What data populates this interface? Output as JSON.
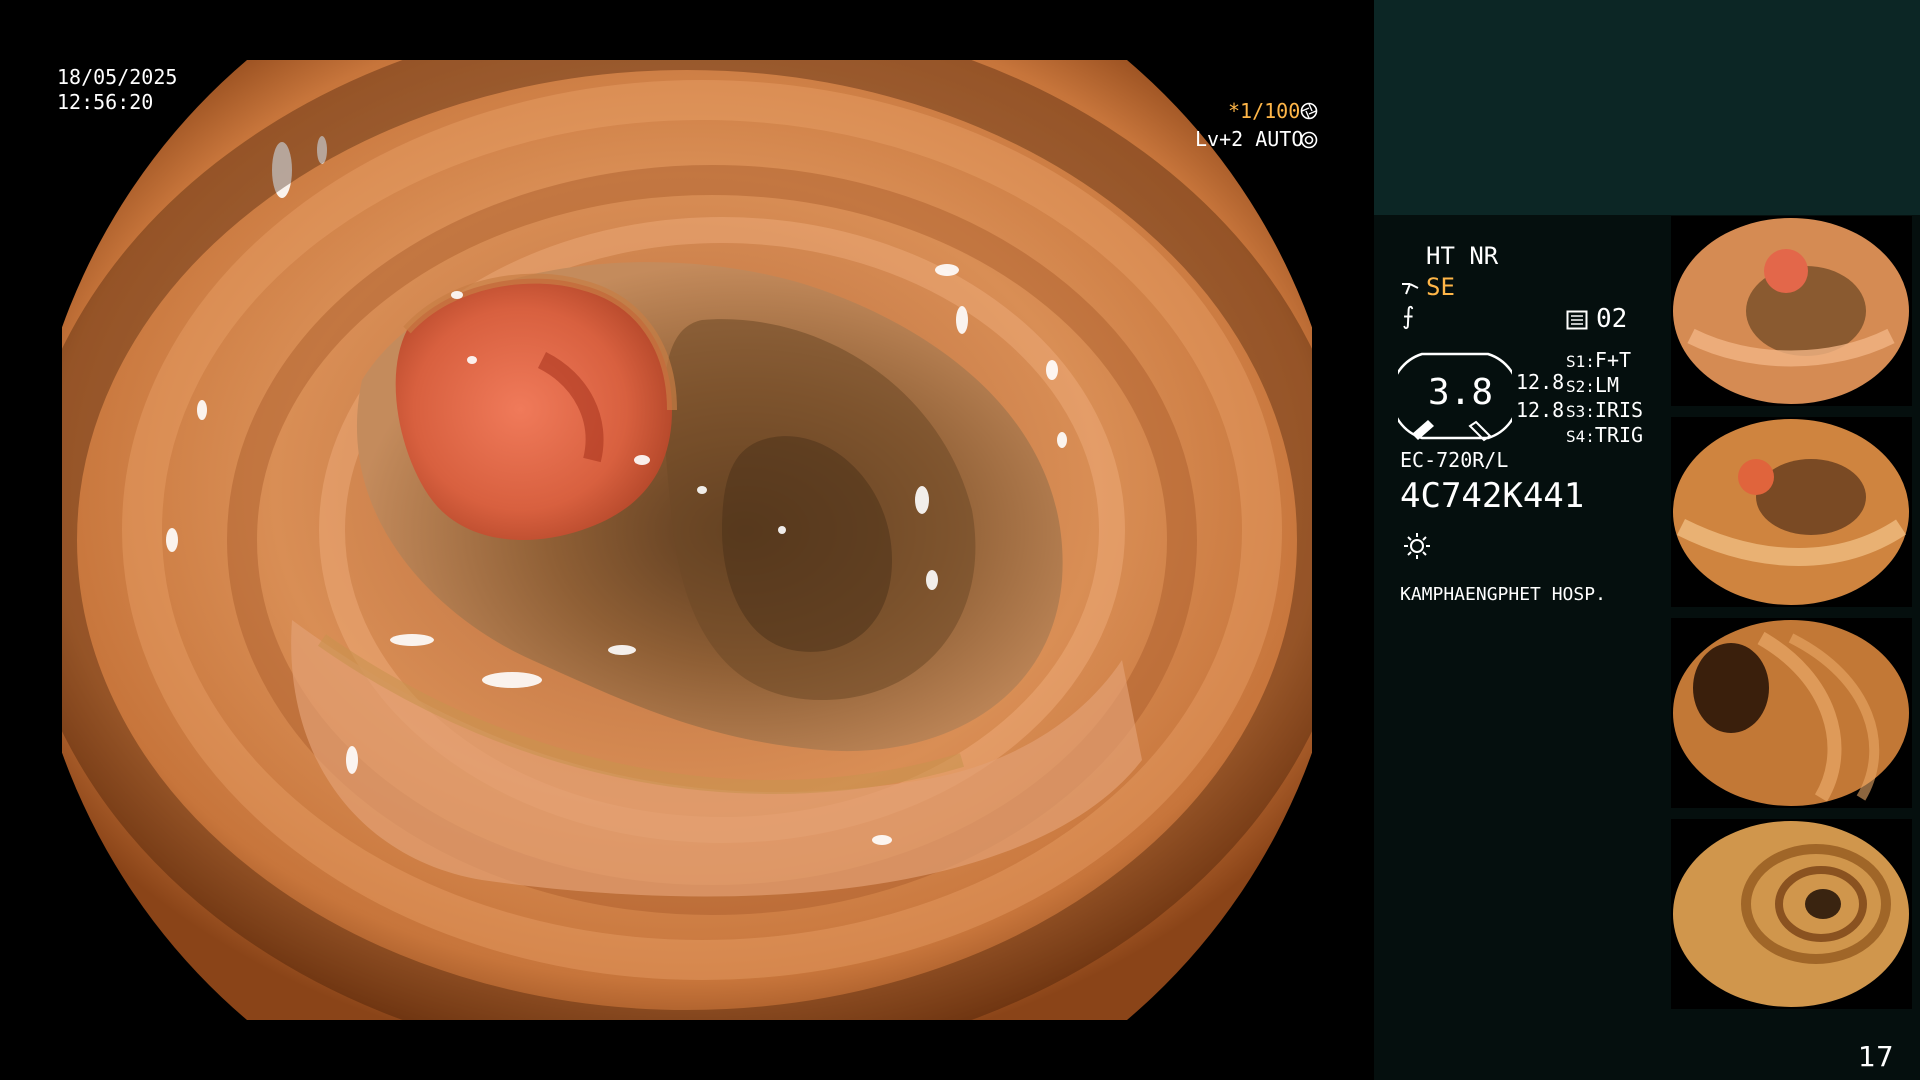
{
  "overlay": {
    "date": "18/05/2025",
    "time": "12:56:20",
    "shutter": "*1/100",
    "shutter_icon": "aperture-icon",
    "level": "Lv+2 AUTO",
    "level_icon": "iris-icon"
  },
  "side": {
    "ht_nr": "HT NR",
    "se": "SE",
    "ce_symbol": "⨍",
    "mem": "02",
    "scope_value": "3.8",
    "ratio_top": "12.8",
    "ratio_bottom": "12.8",
    "s_keys": [
      {
        "key": "S1:",
        "value": "F+T"
      },
      {
        "key": "S2:",
        "value": "LM"
      },
      {
        "key": "S3:",
        "value": "IRIS"
      },
      {
        "key": "S4:",
        "value": "TRIG"
      }
    ],
    "scope_model": "EC-720R/L",
    "serial": "4C742K441",
    "hospital": "KAMPHAENGPHET HOSP.",
    "page_number": "17"
  },
  "colors": {
    "mucosa": "#d78a4e",
    "mucosa_dark": "#7a3c17",
    "polyp": "#e06a4a",
    "panel_top": "#0c2625",
    "panel": "#050f0e",
    "accent": "#ffb648"
  }
}
